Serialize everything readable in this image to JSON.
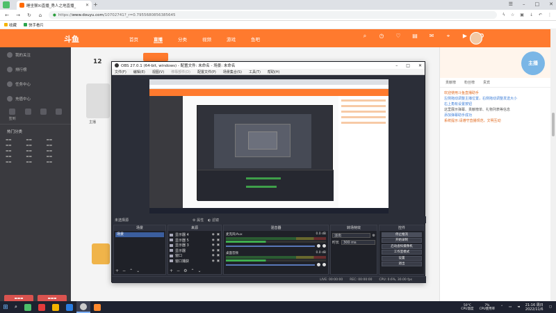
{
  "browser": {
    "tab_title": "睡坐猴Xi直播_秀人之地直播_",
    "url_host": "www.douyu.com",
    "url_path": "/10702741?_r=0.7955680856385645",
    "url_scheme": "https://",
    "bookmarks": [
      {
        "label": "收藏",
        "color": "#f5b400"
      },
      {
        "label": "快手看片",
        "color": "#2da44e"
      }
    ]
  },
  "douyu": {
    "logo": "斗鱼",
    "nav": [
      "首页",
      "直播",
      "分类",
      "视频",
      "游戏",
      "鱼吧"
    ],
    "nav_active": "直播",
    "sidebar_items": [
      "我的关注",
      "排行榜",
      "任务中心",
      "充值中心",
      "签到"
    ],
    "sidebar_section": "热门分类",
    "view_count": "12",
    "anchor_label": "主播",
    "right_tabs": [
      "贡献榜",
      "粉丝榜",
      "贵宾"
    ],
    "chat_system": "欢迎使用斗鱼直播助手",
    "chat_lines": [
      "左侧拖动调整主播位置，右侧拖动调整发送大小",
      "右上角有设置按钮",
      "这里展示弹幕、贡献榜单、礼物列表等信息",
      "添加弹幕助手成功",
      "系统提示:请遵守直播规范，文明互动"
    ],
    "banner_text": "主播"
  },
  "obs": {
    "title": "OBS 27.0.1 (64-bit, windows) - 配置文件: 未命名 - 场景: 未命名",
    "menu": [
      "文件(F)",
      "编辑(E)",
      "视图(V)",
      "停靠部件(D)",
      "配置文件(P)",
      "场景集合(S)",
      "工具(T)",
      "帮助(H)"
    ],
    "no_source": "未选择源",
    "props_btn": "属性",
    "filter_btn": "滤镜",
    "docks": {
      "scenes": "场景",
      "sources": "来源",
      "mixer": "混音器",
      "transitions": "转场特效",
      "controls": "控件"
    },
    "scenes": [
      "场景"
    ],
    "sources": [
      "显示器 4",
      "显示器 5",
      "显示器 3",
      "显示器",
      "窗口",
      "窗口捕获"
    ],
    "mixer": [
      {
        "name": "桌面音频",
        "db": "0.0 dB"
      },
      {
        "name": "麦克风/Aux",
        "db": "0.0 dB"
      }
    ],
    "transition": {
      "type": "淡出",
      "duration_label": "时长",
      "duration": "300 ms"
    },
    "controls": [
      "停止推流",
      "开始录制",
      "启动虚拟摄像机",
      "工作室模式",
      "设置",
      "退出"
    ],
    "status": {
      "live": "LIVE: 00:00:00",
      "rec": "REC: 00:00:00",
      "cpu": "CPU: 0.6%, 30.00 fps"
    }
  },
  "taskbar": {
    "apps": [
      {
        "name": "app-1",
        "color": "#4dbf6a"
      },
      {
        "name": "app-2",
        "color": "#e33b3b"
      },
      {
        "name": "app-3",
        "color": "#f5b400"
      },
      {
        "name": "app-4",
        "color": "#2a7de1"
      },
      {
        "name": "app-5",
        "color": "#cccccc"
      },
      {
        "name": "app-6",
        "color": "#ff8a2e"
      }
    ],
    "cpu_temp": "50°C",
    "cpu_temp_label": "CPU温度",
    "cpu_usage": "7%",
    "cpu_usage_label": "CPU使用率",
    "time": "21:16 周日",
    "date": "2022/11/6"
  },
  "colors": {
    "brand": "#ff7a2e",
    "obs_bg": "#2b2e38"
  }
}
